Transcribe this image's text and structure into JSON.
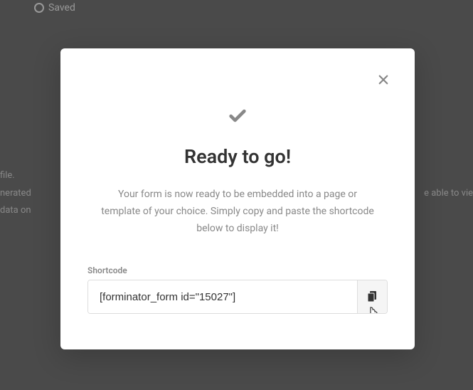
{
  "background": {
    "saved_label": "Saved",
    "left_text_1": "file.",
    "left_text_2": "nerated",
    "left_text_3": "data on",
    "right_text": "e able to vie"
  },
  "modal": {
    "title": "Ready to go!",
    "description": "Your form is now ready to be embedded into a page or template of your choice. Simply copy and paste the shortcode below to display it!",
    "shortcode_label": "Shortcode",
    "shortcode_value": "[forminator_form id=\"15027\"]"
  }
}
